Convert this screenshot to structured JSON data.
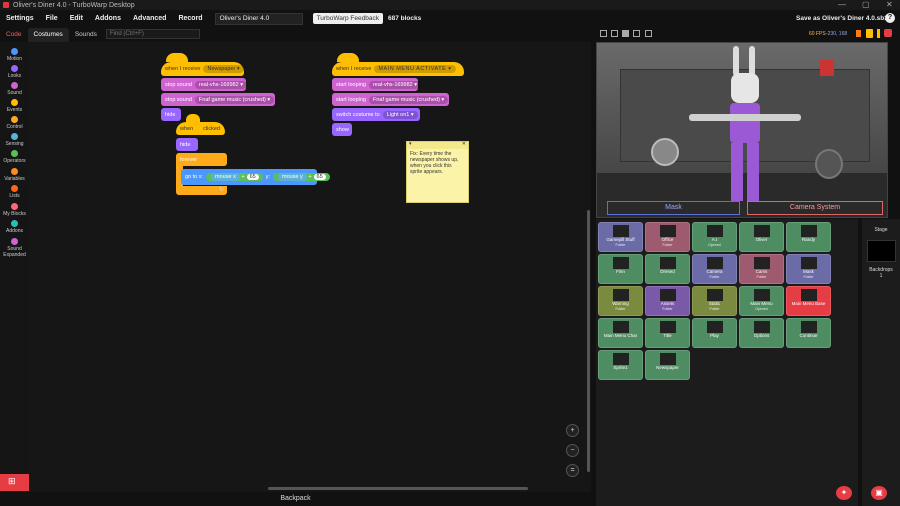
{
  "window": {
    "title": "Oliver's Diner 4.0 - TurboWarp Desktop",
    "controls": [
      "—",
      "▢",
      "✕"
    ]
  },
  "menubar": {
    "items": [
      "Settings",
      "File",
      "Edit",
      "Addons",
      "Advanced",
      "Record"
    ],
    "project_title": "Oliver's Diner 4.0",
    "feedback": "TurboWarp Feedback",
    "block_count": "687 blocks",
    "save_as": "Save as Oliver's Diner 4.0.sb3",
    "help": "?"
  },
  "editor_tabs": {
    "code": "Code",
    "costumes": "Costumes",
    "sounds": "Sounds"
  },
  "find": {
    "placeholder": "Find (Ctrl+F)"
  },
  "categories": [
    {
      "label": "Motion",
      "color": "#4c97ff"
    },
    {
      "label": "Looks",
      "color": "#9966ff"
    },
    {
      "label": "Sound",
      "color": "#cf63cf"
    },
    {
      "label": "Events",
      "color": "#ffbf00"
    },
    {
      "label": "Control",
      "color": "#ffab19"
    },
    {
      "label": "Sensing",
      "color": "#5cb1d6"
    },
    {
      "label": "Operators",
      "color": "#59c059"
    },
    {
      "label": "Variables",
      "color": "#ff8c1a"
    },
    {
      "label": "Lists",
      "color": "#ff661a"
    },
    {
      "label": "My Blocks",
      "color": "#ff6680"
    },
    {
      "label": "Addons",
      "color": "#29beb8"
    },
    {
      "label": "Sound Expanded",
      "color": "#cf63cf"
    }
  ],
  "script1": {
    "hat": "when I receive",
    "hat_msg": "Newspaper ▾",
    "stop1": "stop sound",
    "stop1_arg": "real-vhs-169982 ▾",
    "stop2": "stop sound",
    "stop2_arg": "Fnaf game music (crushed) ▾",
    "hide": "hide",
    "when": "when",
    "when_key": "clicked",
    "hide2": "hide",
    "forever": "forever",
    "goto": "go to x:",
    "mx": "mouse x",
    "plus": "+",
    "n1": "65",
    "y": "y:",
    "my": "mouse y",
    "n2": "65"
  },
  "script2": {
    "hat": "when I receive",
    "hat_msg": "MAIN MENU ACTIVATE ▾",
    "loop1": "start looping",
    "loop1_arg": "real-vhs-169982 ▾",
    "loop2": "start looping",
    "loop2_arg": "Fnaf game music (crushed) ▾",
    "costume": "switch costume to",
    "costume_arg": "Light on1 ▾",
    "show": "show"
  },
  "note": {
    "text": "Fix: Every time the newspaper shows up, when you click this sprite appears."
  },
  "zoom": {
    "in": "+",
    "out": "−",
    "reset": "="
  },
  "backpack": "Backpack",
  "stage_header": {
    "fps": "60 FPS",
    "coords": "-230, 168"
  },
  "stage": {
    "tab_left": "Mask",
    "tab_right": "Camera System"
  },
  "sprites": [
    {
      "name": "Gamepill Stuff",
      "sub": "Folder",
      "color": "#6b6ba8"
    },
    {
      "name": "Office",
      "sub": "Folder",
      "color": "#9e5a6e"
    },
    {
      "name": "A.I",
      "sub": "Opened",
      "color": "#4e8d62"
    },
    {
      "name": "Oliver",
      "sub": "",
      "color": "#4e8d62"
    },
    {
      "name": "Randy",
      "sub": "",
      "color": "#4e8d62"
    },
    {
      "name": "Finn",
      "sub": "",
      "color": "#4e8d62"
    },
    {
      "name": "Dresed",
      "sub": "",
      "color": "#4e8d62"
    },
    {
      "name": "Camera",
      "sub": "Folder",
      "color": "#6b6ba8"
    },
    {
      "name": "Cams",
      "sub": "Folder",
      "color": "#9e5a6e"
    },
    {
      "name": "Mask",
      "sub": "Folder",
      "color": "#6b6ba8"
    },
    {
      "name": "Warning",
      "sub": "Folder",
      "color": "#7a8a3e"
    },
    {
      "name": "Assets",
      "sub": "Folder",
      "color": "#7a5aa8"
    },
    {
      "name": "Static",
      "sub": "Folder",
      "color": "#7a8a3e"
    },
    {
      "name": "Main Menu",
      "sub": "Opened",
      "color": "#4e8d62"
    },
    {
      "name": "Main Menu Base",
      "sub": "",
      "color": "#e63d45"
    },
    {
      "name": "Main Menu Char",
      "sub": "",
      "color": "#4e8d62"
    },
    {
      "name": "Title",
      "sub": "",
      "color": "#4e8d62"
    },
    {
      "name": "Play",
      "sub": "",
      "color": "#4e8d62"
    },
    {
      "name": "Options",
      "sub": "",
      "color": "#4e8d62"
    },
    {
      "name": "Continue",
      "sub": "",
      "color": "#4e8d62"
    },
    {
      "name": "Sprite1",
      "sub": "",
      "color": "#4e8d62"
    },
    {
      "name": "Newspaper",
      "sub": "",
      "color": "#4e8d62"
    }
  ],
  "stage_pane": {
    "label": "Stage",
    "backdrops_label": "Backdrops",
    "backdrops_count": "1"
  }
}
